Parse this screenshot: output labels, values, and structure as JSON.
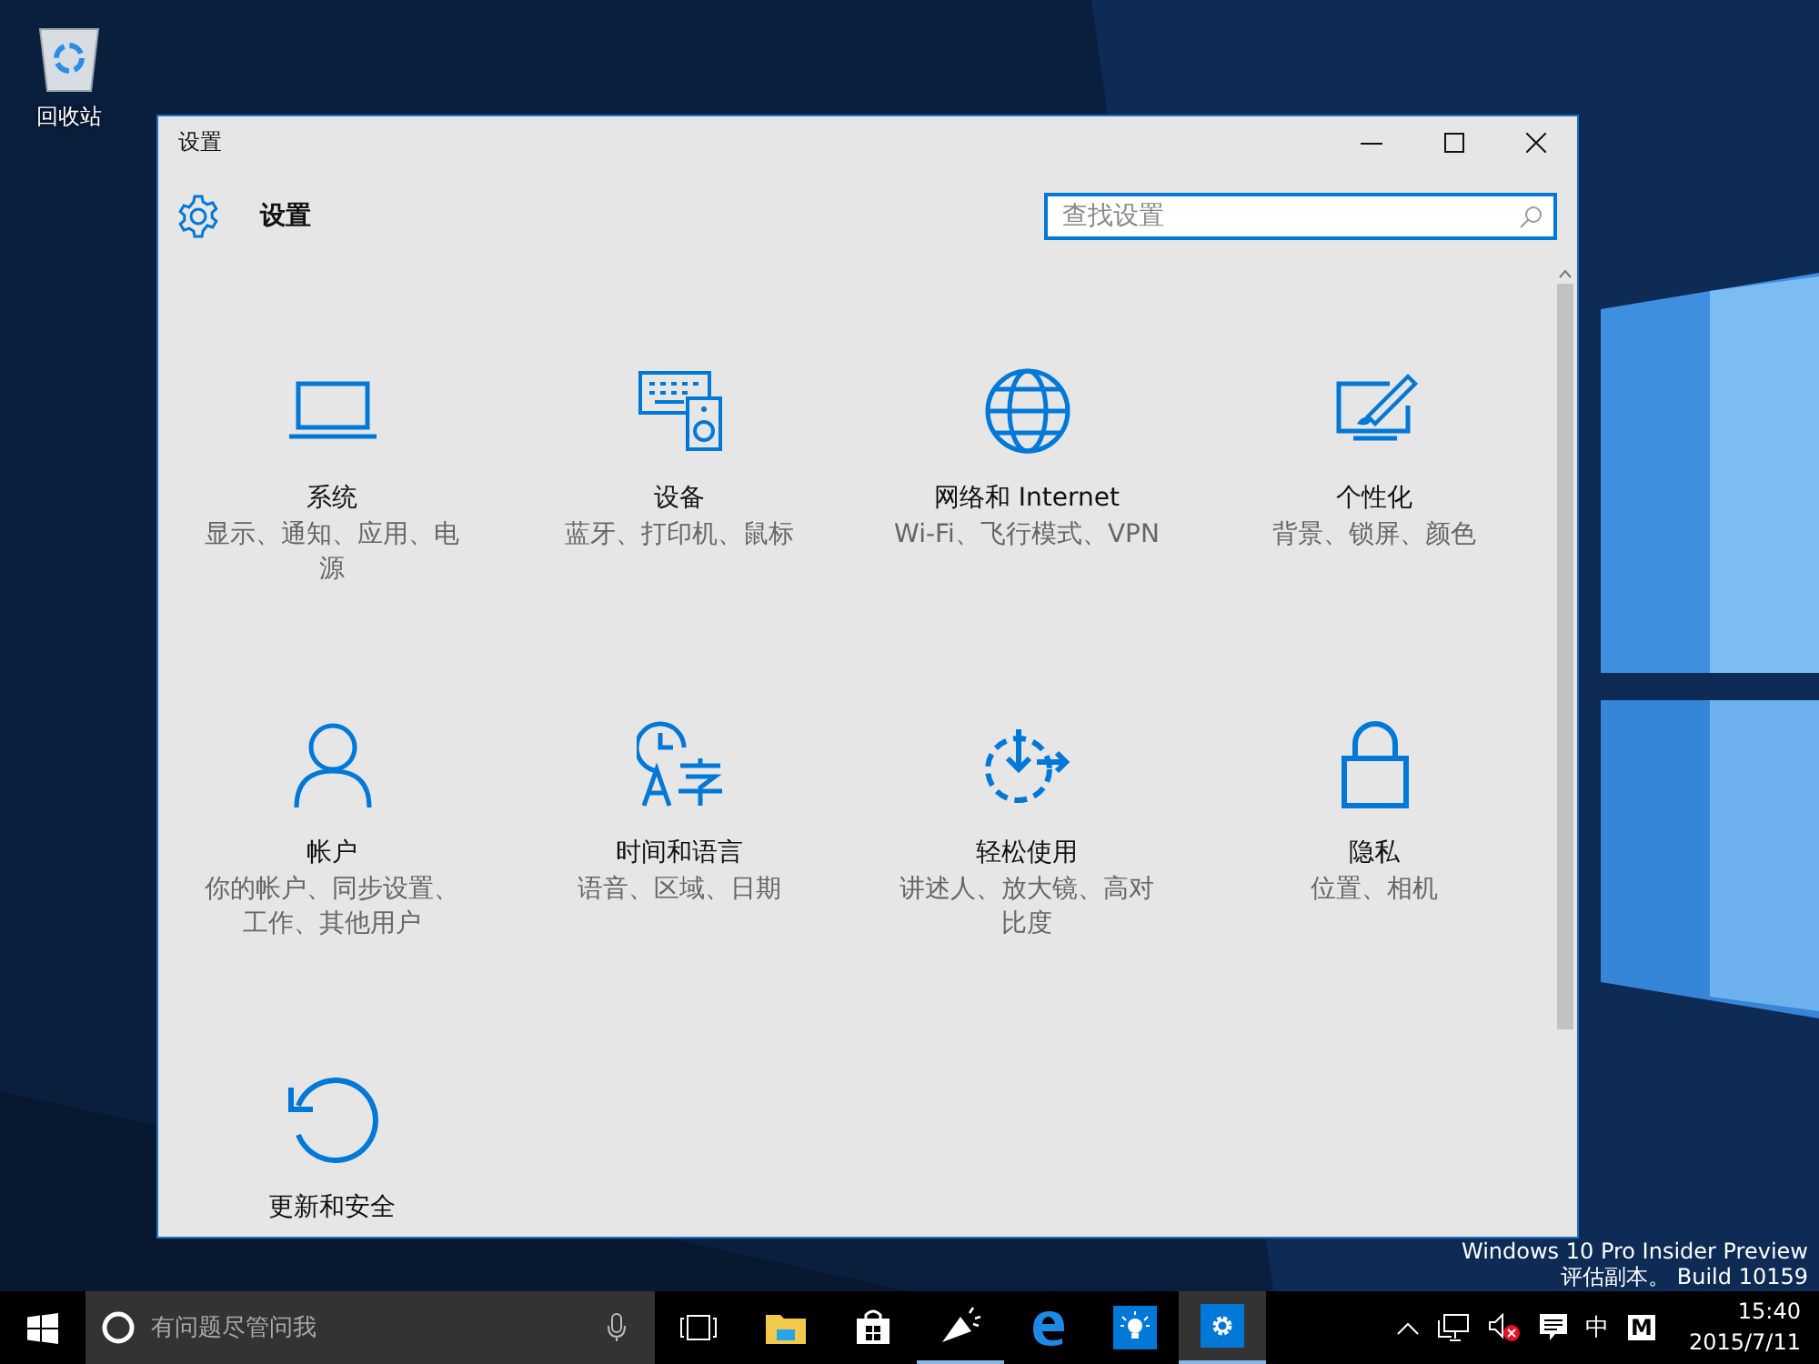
{
  "desktop": {
    "icons": [
      {
        "label": "回收站"
      }
    ],
    "version_notice": [
      "Windows 10 Pro Insider Preview",
      "评估副本。 Build 10159"
    ]
  },
  "window": {
    "title": "设置",
    "header": "设置",
    "search": {
      "placeholder": "查找设置"
    },
    "categories": [
      {
        "kind": "system",
        "title": "系统",
        "description": "显示、通知、应用、电源"
      },
      {
        "kind": "devices",
        "title": "设备",
        "description": "蓝牙、打印机、鼠标"
      },
      {
        "kind": "network",
        "title": "网络和 Internet",
        "description": "Wi-Fi、飞行模式、VPN"
      },
      {
        "kind": "personalization",
        "title": "个性化",
        "description": "背景、锁屏、颜色"
      },
      {
        "kind": "accounts",
        "title": "帐户",
        "description": "你的帐户、同步设置、工作、其他用户"
      },
      {
        "kind": "time",
        "title": "时间和语言",
        "description": "语音、区域、日期"
      },
      {
        "kind": "ease",
        "title": "轻松使用",
        "description": "讲述人、放大镜、高对比度"
      },
      {
        "kind": "privacy",
        "title": "隐私",
        "description": "位置、相机"
      },
      {
        "kind": "update",
        "title": "更新和安全"
      }
    ]
  },
  "taskbar": {
    "search": {
      "placeholder": "有问题尽管问我"
    },
    "apps": [
      {
        "kind": "taskview",
        "running": false,
        "selected": false
      },
      {
        "kind": "explorer",
        "running": false,
        "selected": false
      },
      {
        "kind": "store",
        "running": false,
        "selected": false
      },
      {
        "kind": "announce",
        "running": true,
        "selected": false
      },
      {
        "kind": "edge",
        "running": false,
        "selected": false
      },
      {
        "kind": "tips",
        "running": false,
        "selected": false
      },
      {
        "kind": "settings",
        "running": true,
        "selected": true
      }
    ],
    "tray": {
      "ime": "中",
      "ime_mode": "M",
      "time": "15:40",
      "date": "2015/7/11"
    }
  }
}
